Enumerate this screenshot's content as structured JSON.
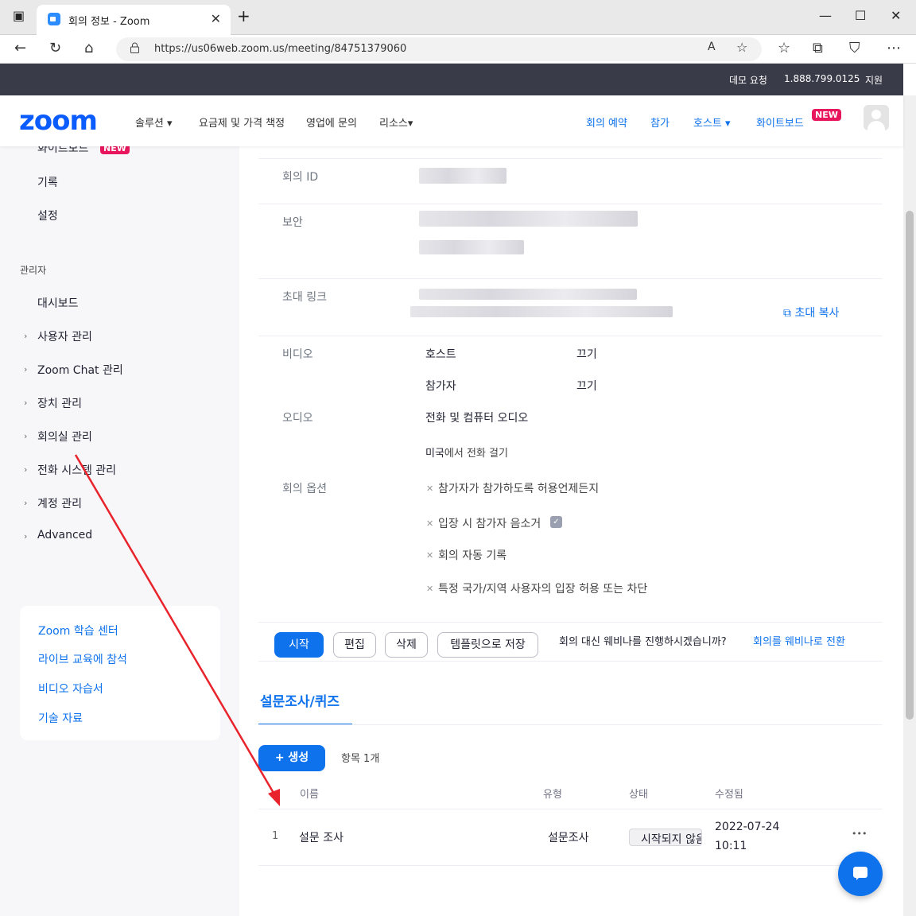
{
  "browser": {
    "tab_title": "회의 정보 - Zoom",
    "url": "https://us06web.zoom.us/meeting/84751379060"
  },
  "topbar": {
    "demo": "데모 요청",
    "phone": "1.888.799.0125",
    "support": "지원"
  },
  "nav": {
    "logo": "zoom",
    "left": [
      "솔루션 ▾",
      "요금제 및 가격 책정",
      "영업에 문의",
      "리소스▾"
    ],
    "right": [
      "회의 예약",
      "참가",
      "호스트 ▾",
      "화이트보드"
    ],
    "new_badge": "NEW"
  },
  "sidebar": {
    "whiteboard_partial": "화이트보드",
    "new_badge": "NEW",
    "top_items": [
      "기록",
      "설정"
    ],
    "admin_header": "관리자",
    "dashboard": "대시보드",
    "admin_items": [
      "사용자 관리",
      "Zoom Chat 관리",
      "장치 관리",
      "회의실 관리",
      "전화 시스템 관리",
      "계정 관리",
      "Advanced"
    ],
    "resources": [
      "Zoom 학습 센터",
      "라이브 교육에 참석",
      "비디오 자습서",
      "기술 자료"
    ]
  },
  "meeting": {
    "id_label": "회의 ID",
    "security_label": "보안",
    "invite_label": "초대 링크",
    "copy_invite": "초대 복사",
    "video_label": "비디오",
    "host_label": "호스트",
    "host_value": "끄기",
    "participant_label": "참가자",
    "participant_value": "끄기",
    "audio_label": "오디오",
    "audio_value": "전화 및 컴퓨터 오디오",
    "dial_country": "미국",
    "dial_suffix": "에서 전화 걸기",
    "options_label": "회의 옵션",
    "options": [
      "참가자가 참가하도록 허용언제든지",
      "입장 시 참가자 음소거",
      "회의 자동 기록",
      "특정 국가/지역 사용자의 입장 허용 또는 차단"
    ]
  },
  "actions": {
    "start": "시작",
    "edit": "편집",
    "delete": "삭제",
    "save_template": "템플릿으로 저장",
    "webinar_prompt": "회의 대신 웨비나를 진행하시겠습니까?",
    "webinar_link": "회의를 웨비나로 전환"
  },
  "polls": {
    "tab": "설문조사/퀴즈",
    "create": "+ 생성",
    "count": "항목 1개",
    "headers": [
      "이름",
      "유형",
      "상태",
      "수정됨"
    ],
    "rows": [
      {
        "num": "1",
        "name": "설문 조사",
        "type": "설문조사",
        "status": "시작되지 않음",
        "date": "2022-07-24",
        "time": "10:11"
      }
    ],
    "more": "•••"
  },
  "colors": {
    "accent": "#0e72ed",
    "annotation_arrow": "#e8232b"
  }
}
